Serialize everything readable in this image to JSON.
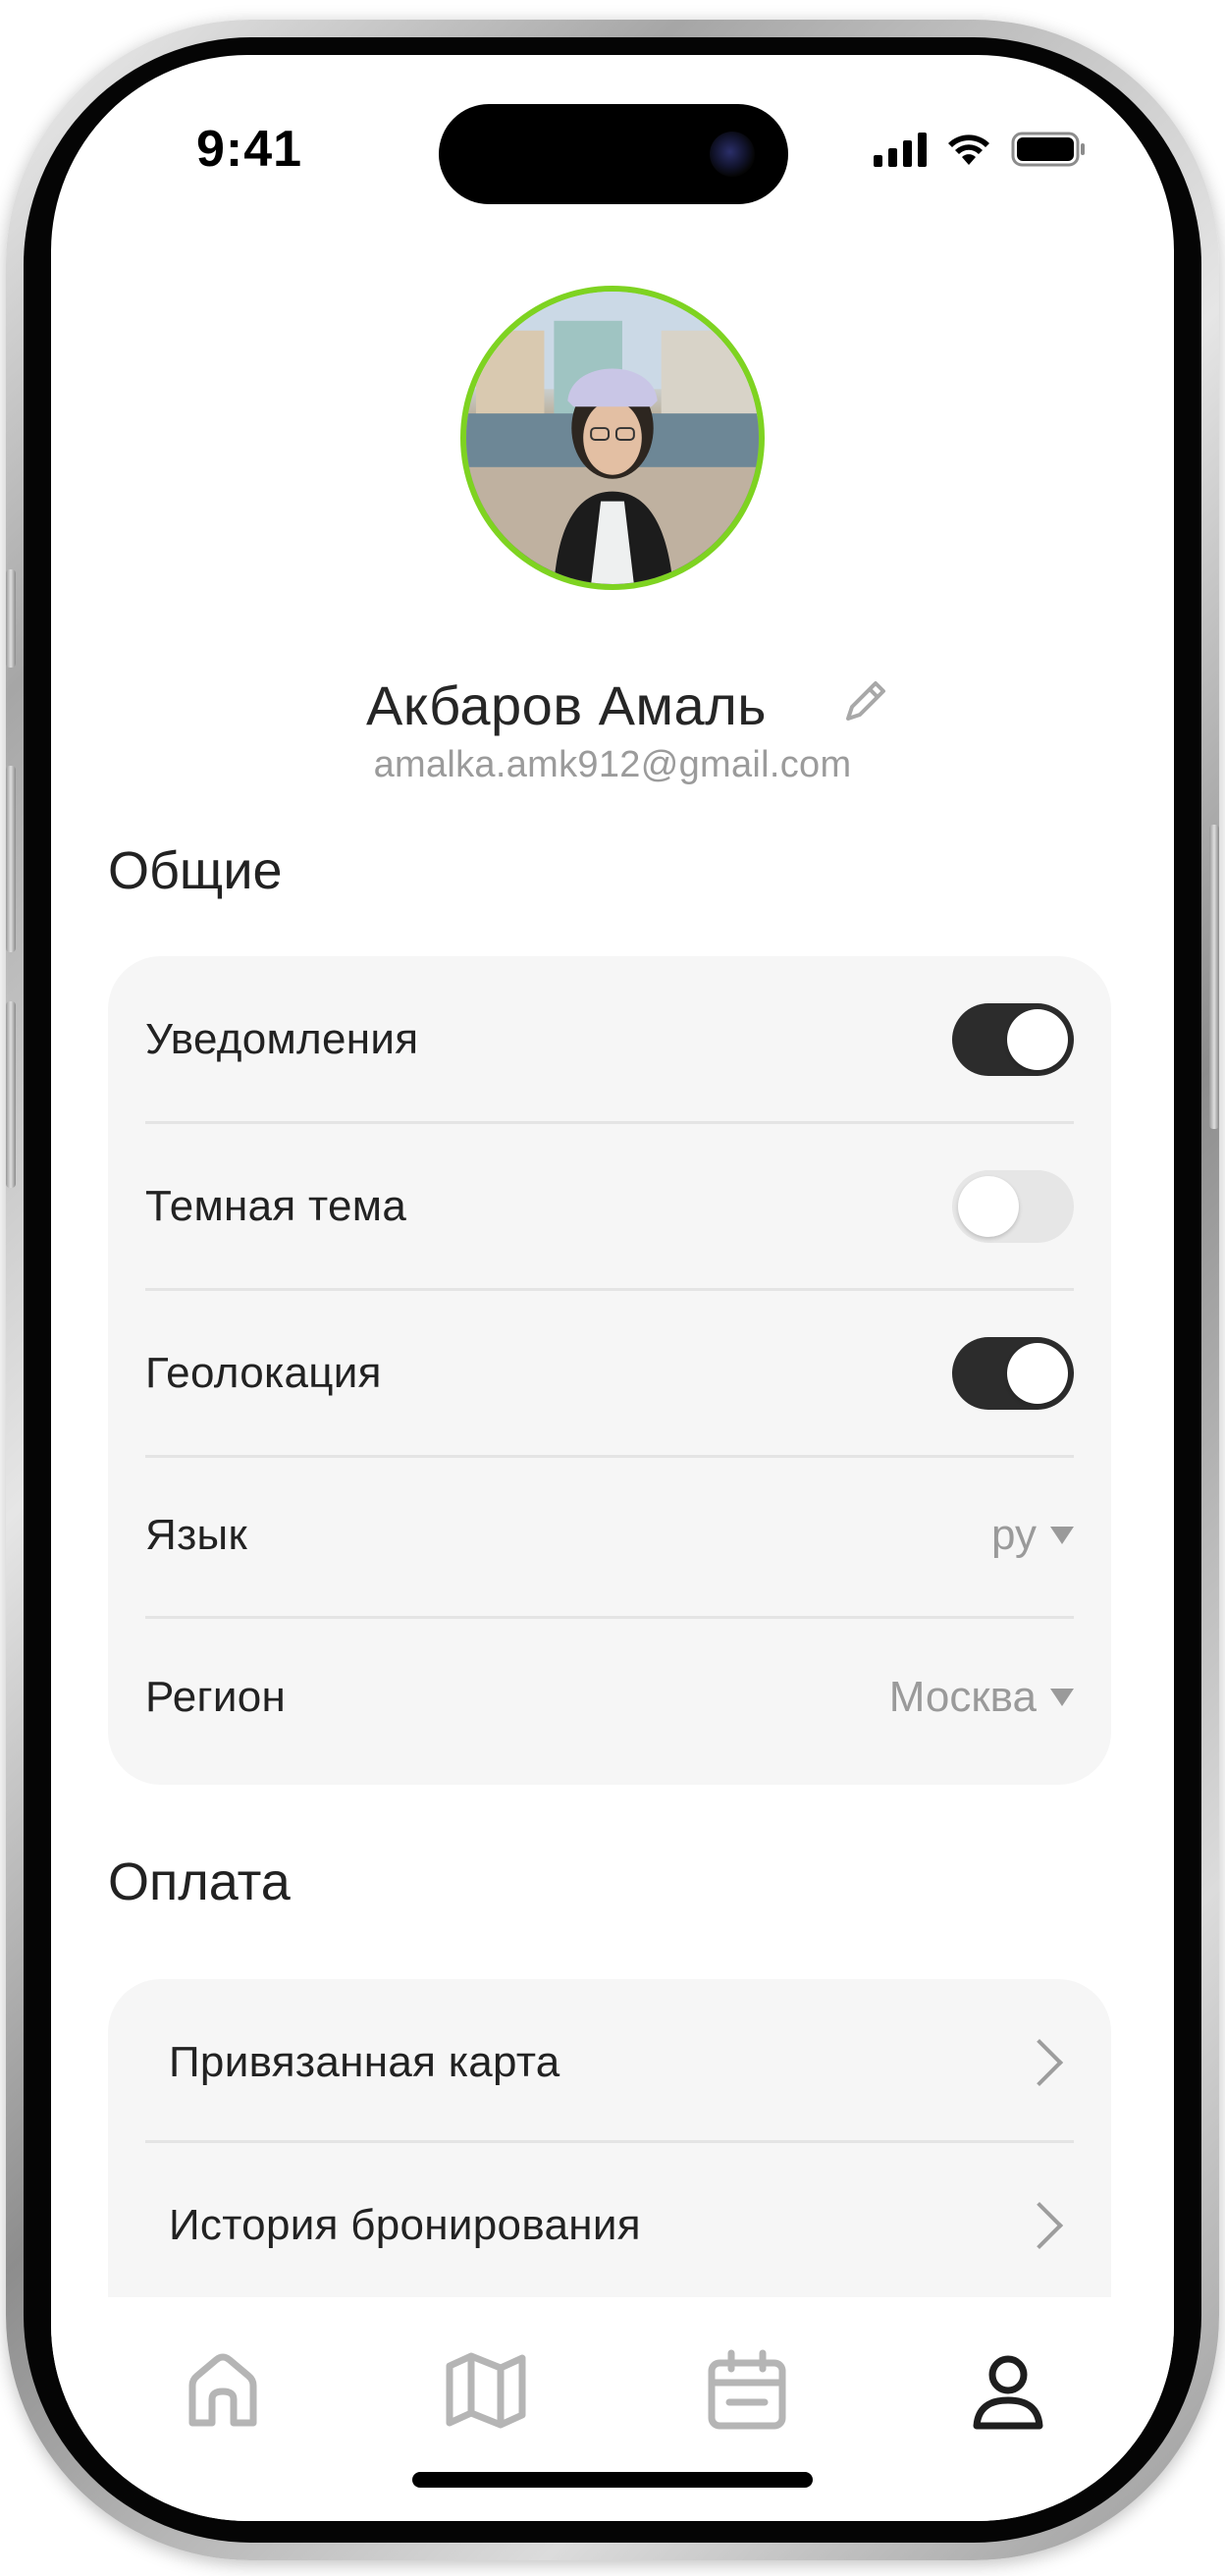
{
  "status_bar": {
    "time": "9:41"
  },
  "profile": {
    "name": "Акбаров Амаль",
    "email": "amalka.amk912@gmail.com",
    "accent_color": "#7ed321"
  },
  "general": {
    "title": "Общие",
    "rows": [
      {
        "label": "Уведомления",
        "type": "toggle",
        "on": true
      },
      {
        "label": "Темная тема",
        "type": "toggle",
        "on": false
      },
      {
        "label": "Геолокация",
        "type": "toggle",
        "on": true
      },
      {
        "label": "Язык",
        "type": "select",
        "value": "ру"
      },
      {
        "label": "Регион",
        "type": "select",
        "value": "Москва"
      }
    ]
  },
  "payment": {
    "title": "Оплата",
    "rows": [
      {
        "label": "Привязанная карта"
      },
      {
        "label": "История бронирования"
      }
    ]
  },
  "nav": {
    "items": [
      {
        "icon": "home-icon",
        "active": false
      },
      {
        "icon": "map-icon",
        "active": false
      },
      {
        "icon": "calendar-icon",
        "active": false
      },
      {
        "icon": "profile-icon",
        "active": true
      }
    ],
    "active_color": "#1e1e1e",
    "inactive_color": "#b5b5b5"
  }
}
